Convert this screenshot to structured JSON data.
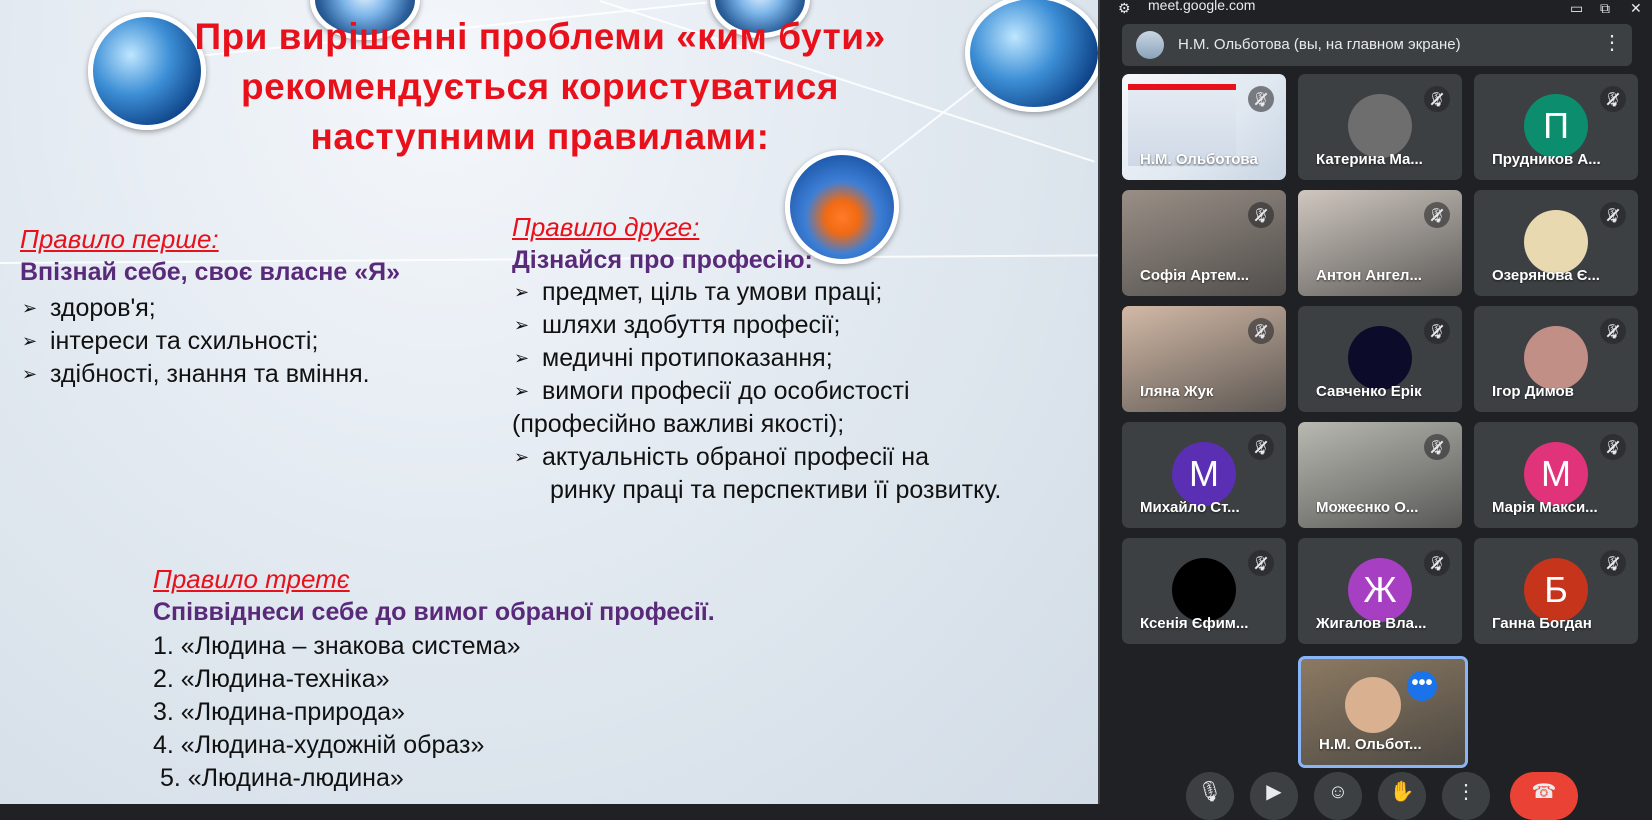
{
  "slide": {
    "title_lines": [
      "При вирішенні проблеми «ким бути»",
      "рекомендується користуватися",
      "наступними правилами:"
    ],
    "rule1": {
      "heading": "Правило перше:",
      "subheading": "Впізнай себе, своє власне «Я»",
      "items": [
        "здоров'я;",
        "інтереси та схильності;",
        "здібності, знання та вміння."
      ]
    },
    "rule2": {
      "heading": "Правило друге:",
      "subheading": "Дізнайся про професію:",
      "items": [
        "предмет, ціль та умови праці;",
        "шляхи здобуття професії;",
        "медичні протипоказання;",
        "вимоги професії до особистості"
      ],
      "continuation": "(професійно важливі якості);",
      "item5": "актуальність обраної професії на",
      "item5_cont": "ринку праці та перспективи її розвитку."
    },
    "rule3": {
      "heading": "Правило третє",
      "subheading": "Співвіднеси себе до вимог обраної професії.",
      "items": [
        "1. «Людина – знакова система»",
        "2. «Людина-техніка»",
        "3. «Людина-природа»",
        "4. «Людина-художній образ»",
        " 5. «Людина-людина»"
      ]
    },
    "bullet_glyph": "➢"
  },
  "meet": {
    "url": "meet.google.com",
    "presenter_label": "Н.М. Ольботова (вы, на главном экране)",
    "participants": [
      {
        "name": "Н.М. Ольботова",
        "kind": "screen"
      },
      {
        "name": "Катерина Ма...",
        "kind": "photo",
        "color": "#6e6e6e"
      },
      {
        "name": "Прудников А...",
        "kind": "letter",
        "letter": "П",
        "color": "#0b8d6e"
      },
      {
        "name": "Софія Артем...",
        "kind": "video",
        "color": "#9a8f86"
      },
      {
        "name": "Антон Ангел...",
        "kind": "video",
        "color": "#cfc7bf"
      },
      {
        "name": "Озерянова Є...",
        "kind": "photo",
        "color": "#e8d9b0"
      },
      {
        "name": "Іляна Жук",
        "kind": "video",
        "color": "#d2b9a6"
      },
      {
        "name": "Савченко Ерік",
        "kind": "photo",
        "color": "#0c0c2a"
      },
      {
        "name": "Ігор Димов",
        "kind": "photo",
        "color": "#c28f86"
      },
      {
        "name": "Михайло Ст...",
        "kind": "letter",
        "letter": "М",
        "color": "#5b2fb3"
      },
      {
        "name": "Можеєнко О...",
        "kind": "video",
        "color": "#b9b9b2"
      },
      {
        "name": "Марія Макси...",
        "kind": "letter",
        "letter": "М",
        "color": "#e0337a"
      },
      {
        "name": "Ксенія Єфим...",
        "kind": "photo",
        "color": "#000000"
      },
      {
        "name": "Жигалов Вла...",
        "kind": "letter",
        "letter": "Ж",
        "color": "#a63fc2"
      },
      {
        "name": "Ганна Богдан",
        "kind": "letter",
        "letter": "Б",
        "color": "#c5341b"
      },
      {
        "name": "Н.М. Ольбот...",
        "kind": "self",
        "color": "#8c7a62"
      }
    ]
  }
}
